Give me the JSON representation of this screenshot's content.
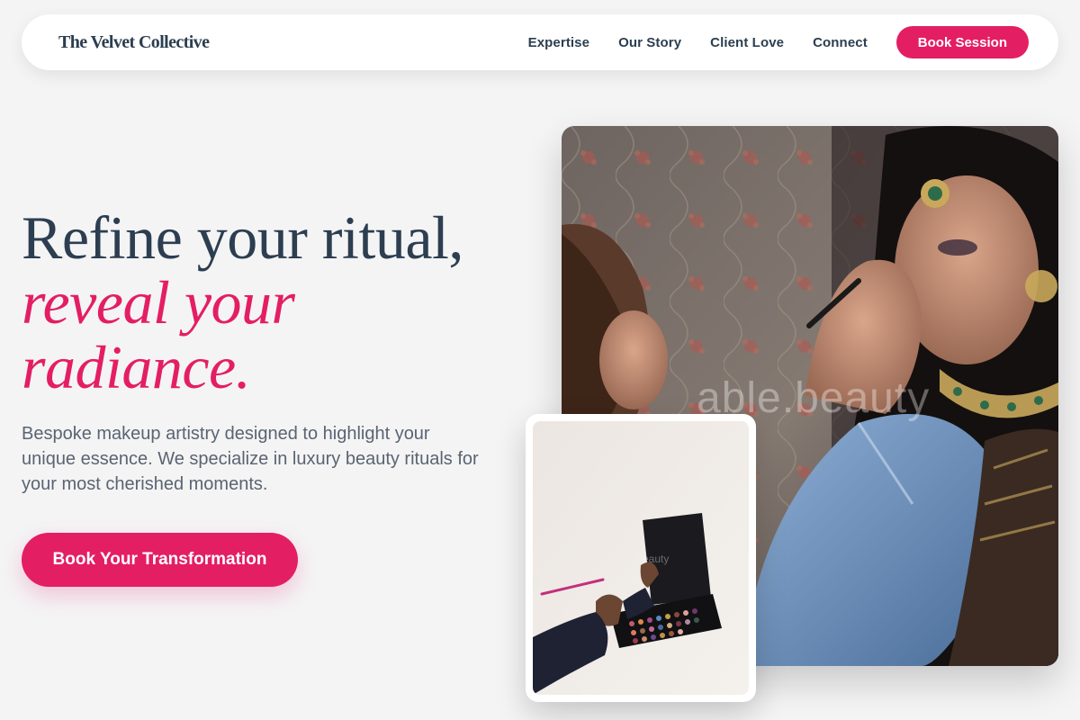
{
  "nav": {
    "brand": "The Velvet Collective",
    "links": [
      "Expertise",
      "Our Story",
      "Client Love",
      "Connect"
    ],
    "cta": "Book Session"
  },
  "hero": {
    "headline_line1": "Refine your ritual,",
    "headline_line2": "reveal your",
    "headline_line3": "radiance.",
    "subtext": "Bespoke makeup artistry designed to highlight your unique essence. We specialize in luxury beauty rituals for your most cherished moments.",
    "cta": "Book Your Transformation"
  },
  "images": {
    "main_watermark": "able.beauty",
    "small_watermark": "eauty"
  },
  "colors": {
    "accent": "#e41e63",
    "text_dark": "#2c3e50",
    "text_muted": "#5a6472",
    "background": "#f4f4f5"
  }
}
